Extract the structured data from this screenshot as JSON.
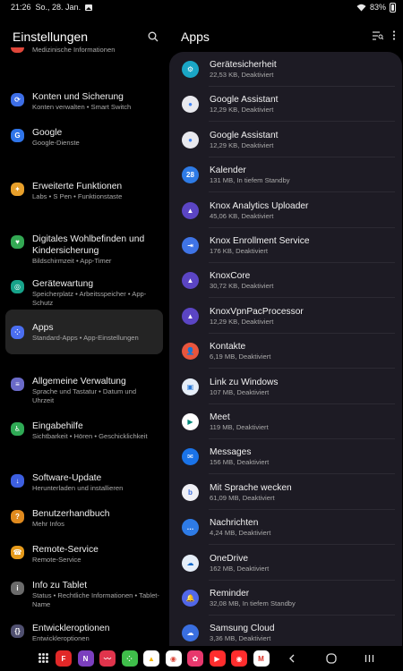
{
  "status_bar": {
    "time": "21:26",
    "date": "So., 28. Jan.",
    "battery": "83%"
  },
  "left": {
    "title": "Einstellungen",
    "partial_item_sub": "Medizinische Informationen",
    "items": [
      {
        "title": "Konten und Sicherung",
        "sub": "Konten verwalten  •  Smart Switch",
        "color": "#3d6ee6",
        "glyph": "⟳"
      },
      {
        "title": "Google",
        "sub": "Google-Dienste",
        "color": "#2f74e8",
        "glyph": "G"
      },
      {
        "title": "Erweiterte Funktionen",
        "sub": "Labs  •  S Pen  •  Funktionstaste",
        "color": "#e8a02b",
        "glyph": "✦"
      },
      {
        "title": "Digitales Wohlbefinden und Kindersicherung",
        "sub": "Bildschirmzeit  •  App-Timer",
        "color": "#33a853",
        "glyph": "♥"
      },
      {
        "title": "Gerätewartung",
        "sub": "Speicherplatz  •  Arbeitsspeicher  •  App-Schutz",
        "color": "#17a38a",
        "glyph": "◎"
      },
      {
        "title": "Apps",
        "sub": "Standard-Apps  •  App-Einstellungen",
        "color": "#4b6ef0",
        "glyph": "⁘"
      },
      {
        "title": "Allgemeine Verwaltung",
        "sub": "Sprache und Tastatur  •  Datum und Uhrzeit",
        "color": "#6a6ac8",
        "glyph": "≡"
      },
      {
        "title": "Eingabehilfe",
        "sub": "Sichtbarkeit  •  Hören  •  Geschicklichkeit",
        "color": "#2faa55",
        "glyph": "♿"
      },
      {
        "title": "Software-Update",
        "sub": "Herunterladen und installieren",
        "color": "#3d5fe0",
        "glyph": "↓"
      },
      {
        "title": "Benutzerhandbuch",
        "sub": "Mehr Infos",
        "color": "#e08a1e",
        "glyph": "?"
      },
      {
        "title": "Remote-Service",
        "sub": "Remote-Service",
        "color": "#e59a1b",
        "glyph": "☎"
      },
      {
        "title": "Info zu Tablet",
        "sub": "Status  •  Rechtliche Informationen  •  Tablet-Name",
        "color": "#6b6b6b",
        "glyph": "i"
      },
      {
        "title": "Entwickleroptionen",
        "sub": "Entwickleroptionen",
        "color": "#505070",
        "glyph": "{}"
      }
    ]
  },
  "right": {
    "title": "Apps",
    "apps": [
      {
        "name": "Gerätesicherheit",
        "meta": "22,53 KB, Deaktiviert",
        "color": "#1aa6c6",
        "glyph": "⚙"
      },
      {
        "name": "Google Assistant",
        "meta": "12,29 KB, Deaktiviert",
        "color": "#e9e9ee",
        "glyph": "●",
        "fg": "#4285f4"
      },
      {
        "name": "Google Assistant",
        "meta": "12,29 KB, Deaktiviert",
        "color": "#e9e9ee",
        "glyph": "●",
        "fg": "#4285f4"
      },
      {
        "name": "Kalender",
        "meta": "131 MB, In tiefem Standby",
        "color": "#2e7be6",
        "glyph": "28"
      },
      {
        "name": "Knox Analytics Uploader",
        "meta": "45,06 KB, Deaktiviert",
        "color": "#5b45c4",
        "glyph": "▲"
      },
      {
        "name": "Knox Enrollment Service",
        "meta": "176 KB, Deaktiviert",
        "color": "#3f74e6",
        "glyph": "⇥"
      },
      {
        "name": "KnoxCore",
        "meta": "30,72 KB, Deaktiviert",
        "color": "#5b45c4",
        "glyph": "▲"
      },
      {
        "name": "KnoxVpnPacProcessor",
        "meta": "12,29 KB, Deaktiviert",
        "color": "#5b45c4",
        "glyph": "▲"
      },
      {
        "name": "Kontakte",
        "meta": "6,19 MB, Deaktiviert",
        "color": "#e8553d",
        "glyph": "👤"
      },
      {
        "name": "Link zu Windows",
        "meta": "107 MB, Deaktiviert",
        "color": "#e6eef8",
        "glyph": "▣",
        "fg": "#2a7ad8"
      },
      {
        "name": "Meet",
        "meta": "119 MB, Deaktiviert",
        "color": "#ffffff",
        "glyph": "▶",
        "fg": "#00897b"
      },
      {
        "name": "Messages",
        "meta": "156 MB, Deaktiviert",
        "color": "#1a73e8",
        "glyph": "✉"
      },
      {
        "name": "Mit Sprache wecken",
        "meta": "61,09 MB, Deaktiviert",
        "color": "#f0f0f5",
        "glyph": "b",
        "fg": "#3c6fe0"
      },
      {
        "name": "Nachrichten",
        "meta": "4,24 MB, Deaktiviert",
        "color": "#2e7be6",
        "glyph": "…"
      },
      {
        "name": "OneDrive",
        "meta": "162 MB, Deaktiviert",
        "color": "#e6eef8",
        "glyph": "☁",
        "fg": "#0f66c8"
      },
      {
        "name": "Reminder",
        "meta": "32,08 MB, In tiefem Standby",
        "color": "#5167e8",
        "glyph": "🔔"
      },
      {
        "name": "Samsung Cloud",
        "meta": "3,36 MB, Deaktiviert",
        "color": "#3a6fe0",
        "glyph": "☁"
      }
    ]
  },
  "taskbar": {
    "apps": [
      {
        "name": "flipboard",
        "color": "#e12828",
        "glyph": "F"
      },
      {
        "name": "onenote",
        "color": "#7b3fbe",
        "glyph": "N"
      },
      {
        "name": "voice-recorder",
        "color": "#e0344c",
        "glyph": "〰"
      },
      {
        "name": "game-launcher",
        "color": "#3fbe4a",
        "glyph": "⁘"
      },
      {
        "name": "google-drive",
        "color": "#ffffff",
        "glyph": "▲",
        "fg": "#f4b400"
      },
      {
        "name": "chrome",
        "color": "#ffffff",
        "glyph": "◉",
        "fg": "#db4437"
      },
      {
        "name": "bixby-flower",
        "color": "#e8386d",
        "glyph": "✿"
      },
      {
        "name": "youtube",
        "color": "#ff2d2d",
        "glyph": "▶"
      },
      {
        "name": "youtube-music",
        "color": "#ff2d2d",
        "glyph": "◉"
      },
      {
        "name": "gmail",
        "color": "#ffffff",
        "glyph": "M",
        "fg": "#d93025"
      }
    ]
  }
}
